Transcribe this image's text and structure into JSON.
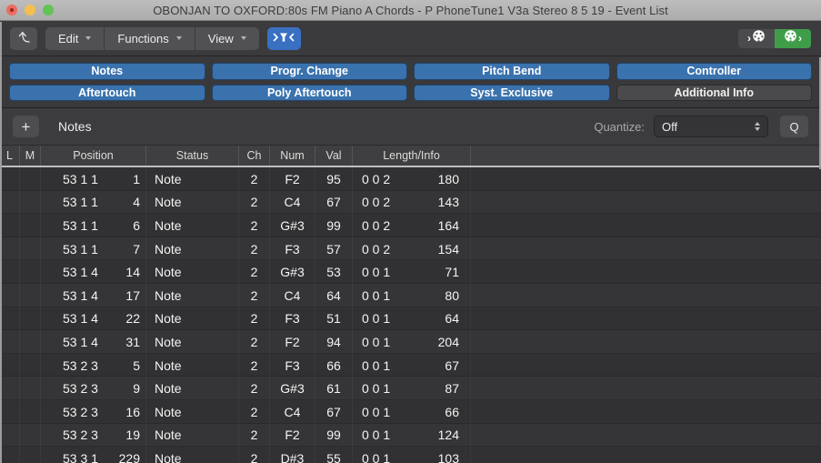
{
  "window": {
    "title": "OBONJAN TO OXFORD:80s FM Piano A Chords - P PhoneTune1 V3a Stereo 8 5 19 - Event List"
  },
  "toolbar": {
    "menus": [
      {
        "label": "Edit"
      },
      {
        "label": "Functions"
      },
      {
        "label": "View"
      }
    ]
  },
  "icons": {
    "up_arrow": "curved-up-arrow",
    "event_filter": "funnel-with-chevrons",
    "midi_in": "din-plug-chevron-left",
    "midi_out": "din-plug-chevron-right",
    "plus": "+",
    "menu_chevron": "chevron-down",
    "quantize_stepper": "up-down-arrows"
  },
  "filter_panel": {
    "buttons": [
      {
        "label": "Notes",
        "style": "blue"
      },
      {
        "label": "Progr. Change",
        "style": "blue"
      },
      {
        "label": "Pitch Bend",
        "style": "blue"
      },
      {
        "label": "Controller",
        "style": "blue"
      },
      {
        "label": "Aftertouch",
        "style": "blue"
      },
      {
        "label": "Poly Aftertouch",
        "style": "blue"
      },
      {
        "label": "Syst. Exclusive",
        "style": "blue"
      },
      {
        "label": "Additional Info",
        "style": "gray"
      }
    ]
  },
  "list_header": {
    "plus": "+",
    "title": "Notes",
    "quantize_label": "Quantize:",
    "quantize_value": "Off",
    "q_button": "Q"
  },
  "table": {
    "columns": [
      "L",
      "M",
      "Position",
      "Status",
      "Ch",
      "Num",
      "Val",
      "Length/Info"
    ],
    "rows": [
      {
        "position": "53 1 1",
        "tick": "1",
        "status": "Note",
        "ch": "2",
        "num": "F2",
        "val": "95",
        "length": "0 0 2",
        "length_val": "180"
      },
      {
        "position": "53 1 1",
        "tick": "4",
        "status": "Note",
        "ch": "2",
        "num": "C4",
        "val": "67",
        "length": "0 0 2",
        "length_val": "143"
      },
      {
        "position": "53 1 1",
        "tick": "6",
        "status": "Note",
        "ch": "2",
        "num": "G#3",
        "val": "99",
        "length": "0 0 2",
        "length_val": "164"
      },
      {
        "position": "53 1 1",
        "tick": "7",
        "status": "Note",
        "ch": "2",
        "num": "F3",
        "val": "57",
        "length": "0 0 2",
        "length_val": "154"
      },
      {
        "position": "53 1 4",
        "tick": "14",
        "status": "Note",
        "ch": "2",
        "num": "G#3",
        "val": "53",
        "length": "0 0 1",
        "length_val": "71"
      },
      {
        "position": "53 1 4",
        "tick": "17",
        "status": "Note",
        "ch": "2",
        "num": "C4",
        "val": "64",
        "length": "0 0 1",
        "length_val": "80"
      },
      {
        "position": "53 1 4",
        "tick": "22",
        "status": "Note",
        "ch": "2",
        "num": "F3",
        "val": "51",
        "length": "0 0 1",
        "length_val": "64"
      },
      {
        "position": "53 1 4",
        "tick": "31",
        "status": "Note",
        "ch": "2",
        "num": "F2",
        "val": "94",
        "length": "0 0 1",
        "length_val": "204"
      },
      {
        "position": "53 2 3",
        "tick": "5",
        "status": "Note",
        "ch": "2",
        "num": "F3",
        "val": "66",
        "length": "0 0 1",
        "length_val": "67"
      },
      {
        "position": "53 2 3",
        "tick": "9",
        "status": "Note",
        "ch": "2",
        "num": "G#3",
        "val": "61",
        "length": "0 0 1",
        "length_val": "87"
      },
      {
        "position": "53 2 3",
        "tick": "16",
        "status": "Note",
        "ch": "2",
        "num": "C4",
        "val": "67",
        "length": "0 0 1",
        "length_val": "66"
      },
      {
        "position": "53 2 3",
        "tick": "19",
        "status": "Note",
        "ch": "2",
        "num": "F2",
        "val": "99",
        "length": "0 0 1",
        "length_val": "124"
      },
      {
        "position": "53 3 1",
        "tick": "229",
        "status": "Note",
        "ch": "2",
        "num": "D#3",
        "val": "55",
        "length": "0 0 1",
        "length_val": "103"
      }
    ]
  },
  "colors": {
    "filter_blue": "#3a72ae",
    "toolbar_filter_blue": "#3a70c2",
    "midi_green": "#3f9d4a",
    "titlebar_bg": "#b5b5b5",
    "panel_bg": "#39393b",
    "body_bg": "#313133",
    "header_underline": "#bfbfbf"
  }
}
